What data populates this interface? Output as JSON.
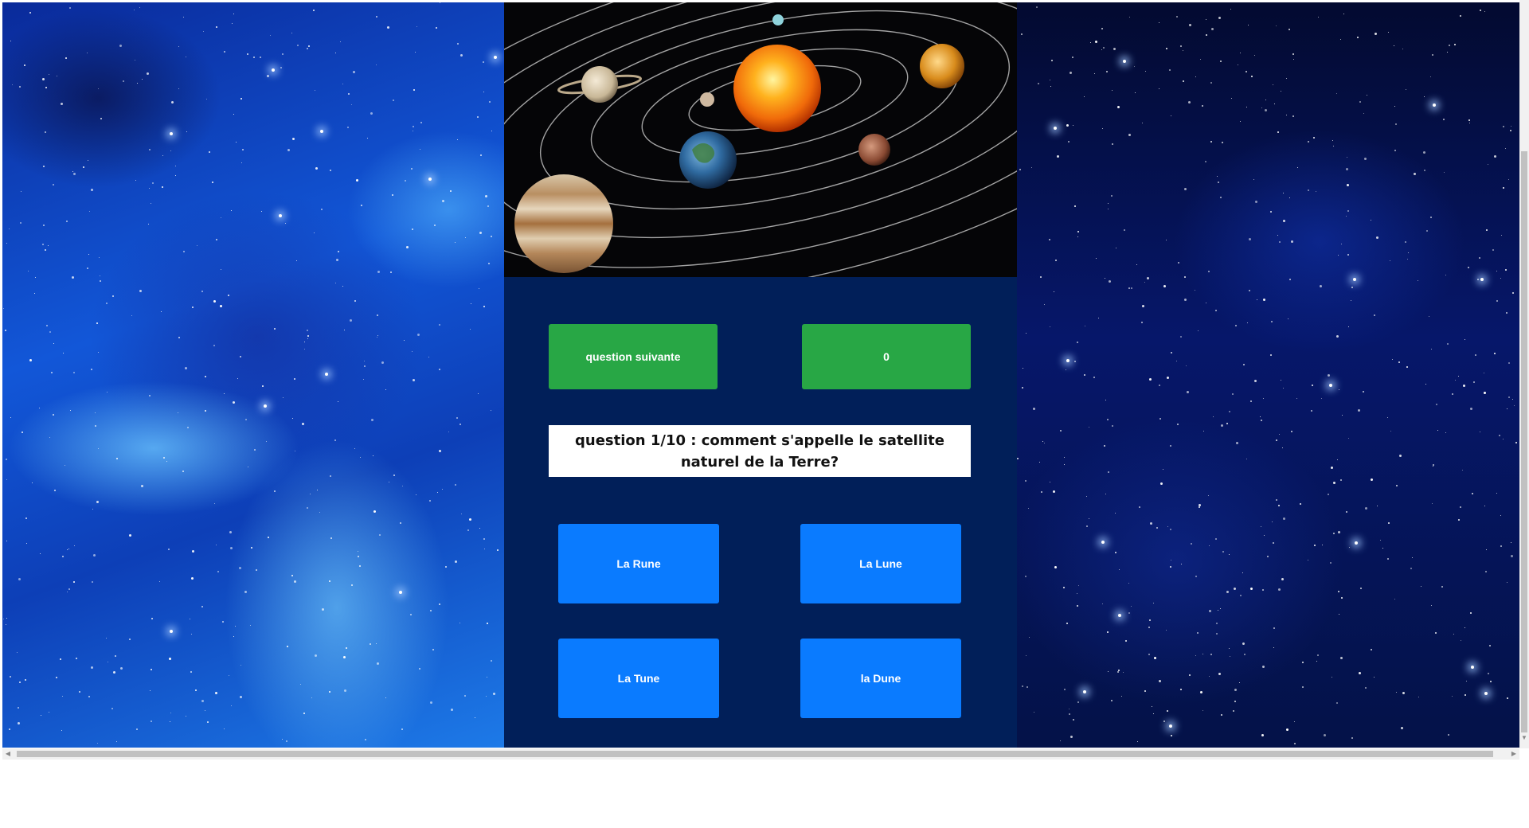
{
  "controls": {
    "next_label": "question suivante",
    "score": "0"
  },
  "question": {
    "text": "question 1/10 : comment s'appelle le satellite naturel de la Terre?"
  },
  "answers": [
    {
      "label": "La Rune"
    },
    {
      "label": "La Lune"
    },
    {
      "label": "La Tune"
    },
    {
      "label": "la Dune"
    }
  ],
  "colors": {
    "panel_bg": "#011f59",
    "green_button": "#28a745",
    "blue_button": "#0a7bff"
  }
}
